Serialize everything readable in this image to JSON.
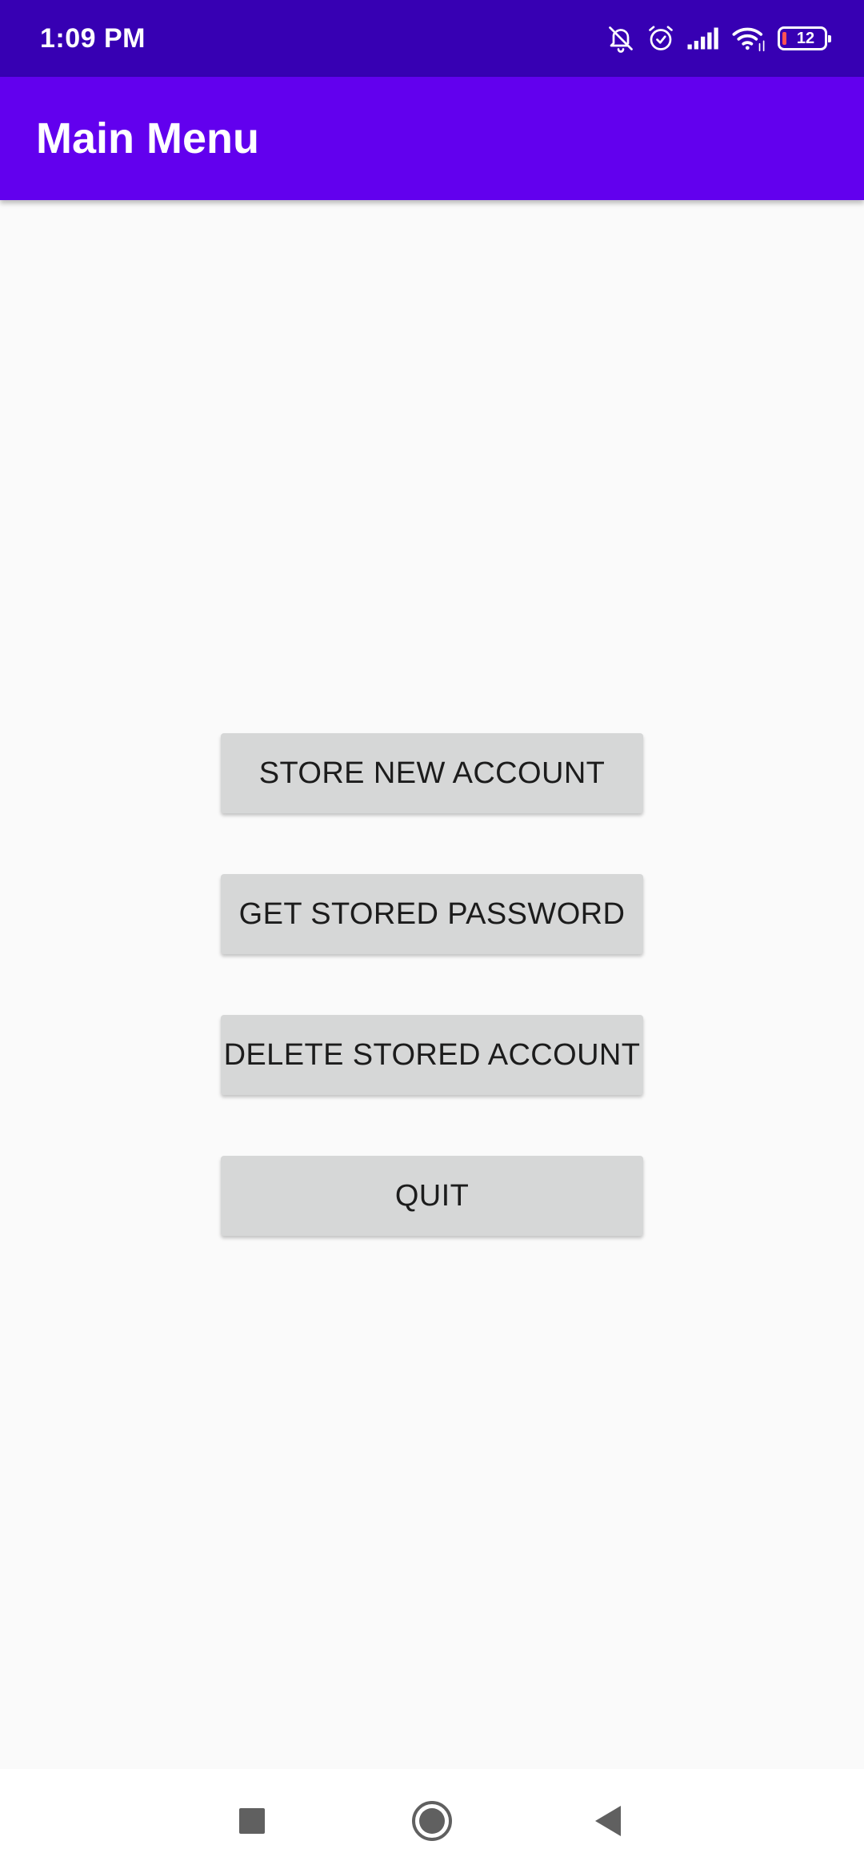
{
  "status_bar": {
    "time": "1:09 PM",
    "battery_level": "12",
    "icons": [
      "bell-off-icon",
      "alarm-icon",
      "signal-icon",
      "wifi-icon",
      "battery-icon"
    ]
  },
  "app_bar": {
    "title": "Main Menu"
  },
  "menu": {
    "store_new_account": "STORE NEW ACCOUNT",
    "get_stored_password": "GET STORED PASSWORD",
    "delete_stored_account": "DELETE STORED ACCOUNT",
    "quit": "QUIT"
  },
  "nav_bar": {
    "icons": [
      "recents-icon",
      "home-icon",
      "back-icon"
    ]
  },
  "colors": {
    "status_bar": "#3700b3",
    "app_bar": "#6200ee",
    "button": "#d6d7d7",
    "background": "#fafafa"
  }
}
